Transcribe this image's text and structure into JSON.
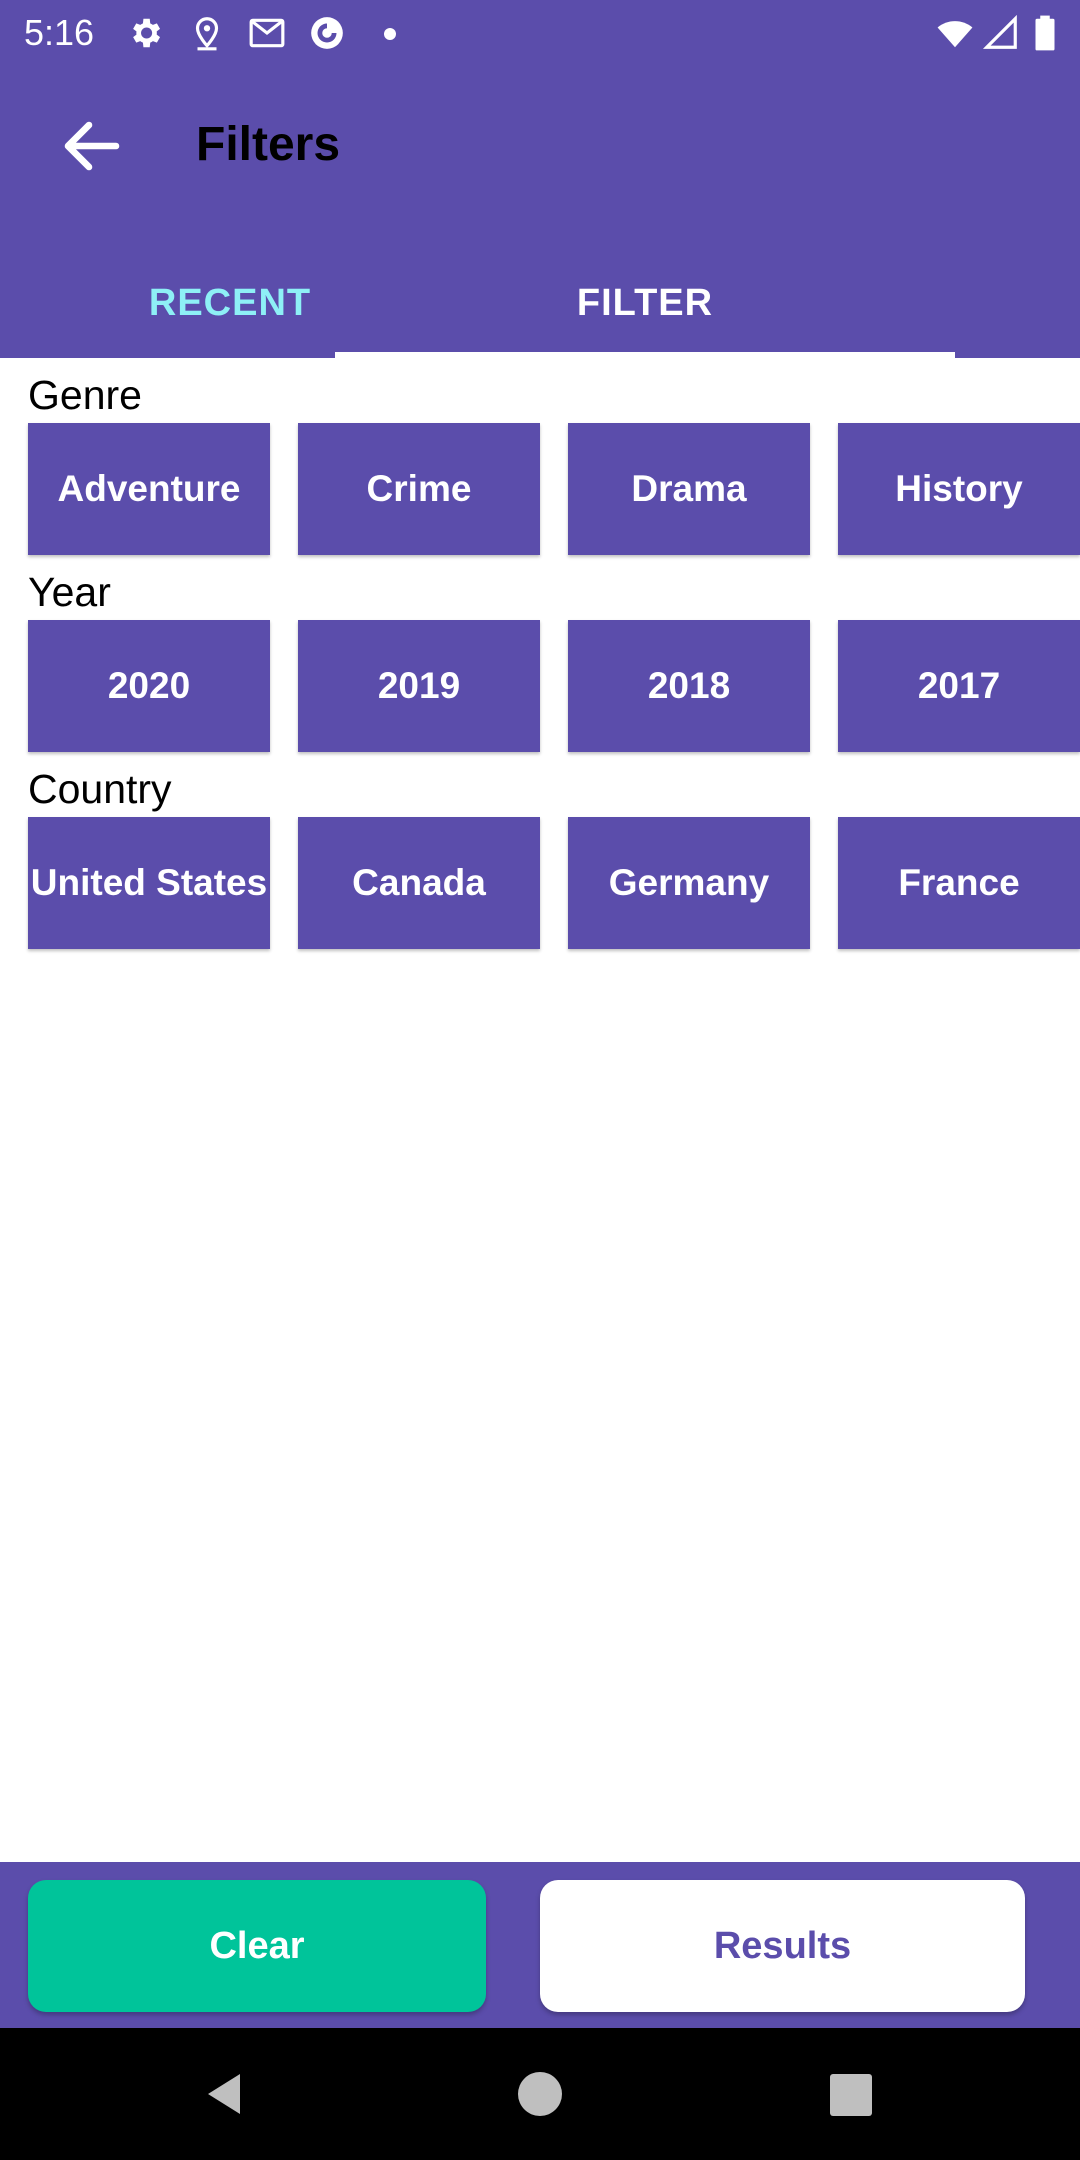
{
  "status_bar": {
    "time": "5:16",
    "icons": [
      "gear-icon",
      "location-pin-icon",
      "gmail-icon",
      "sync-app-icon",
      "notification-dot-icon",
      "wifi-icon",
      "cell-signal-icon",
      "battery-icon"
    ]
  },
  "app_bar": {
    "title": "Filters",
    "back_icon": "arrow-back-icon",
    "tabs": [
      {
        "label": "RECENT",
        "selected": false
      },
      {
        "label": "FILTER",
        "selected": true
      }
    ]
  },
  "sections": {
    "genre": {
      "label": "Genre",
      "options": [
        "Adventure",
        "Crime",
        "Drama",
        "History"
      ]
    },
    "year": {
      "label": "Year",
      "options": [
        "2020",
        "2019",
        "2018",
        "2017"
      ]
    },
    "country": {
      "label": "Country",
      "options": [
        "United States",
        "Canada",
        "Germany",
        "France"
      ]
    }
  },
  "actions": {
    "clear_label": "Clear",
    "results_label": "Results"
  },
  "colors": {
    "primary": "#5b4dab",
    "tab_inactive": "#8ef0f6",
    "clear_button": "#00c49a",
    "background": "#ffffff"
  },
  "nav_bar": {
    "icons": [
      "nav-back-icon",
      "nav-home-icon",
      "nav-recents-icon"
    ]
  }
}
